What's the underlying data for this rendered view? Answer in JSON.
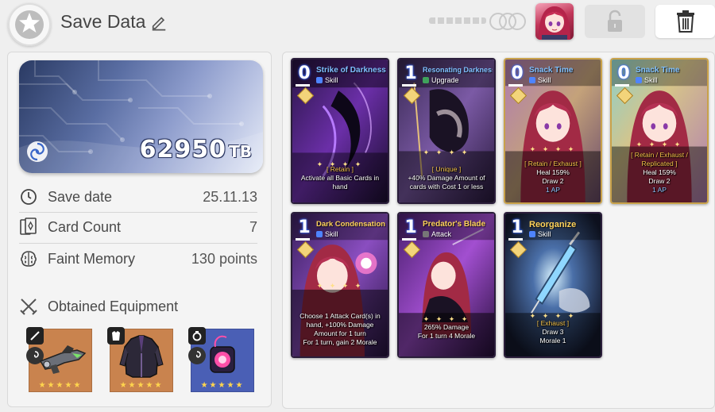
{
  "header": {
    "title": "Save Data"
  },
  "summary": {
    "value": "62950",
    "unit": "TB",
    "rows": [
      {
        "label": "Save date",
        "value": "25.11.13"
      },
      {
        "label": "Card Count",
        "value": "7"
      },
      {
        "label": "Faint Memory",
        "value": "130 points"
      }
    ],
    "equipment_title": "Obtained Equipment",
    "equipment": [
      {
        "name": "weapon",
        "bg": "#c8844f",
        "stars": "★★★★★"
      },
      {
        "name": "armor",
        "bg": "#c8844f",
        "stars": "★★★★★"
      },
      {
        "name": "accessory",
        "bg": "#4b63b8",
        "stars": "★★★★★"
      }
    ]
  },
  "cards": [
    {
      "cost": "0",
      "name": "Strike of Darkness",
      "name_color": "#7fc0ff",
      "type": "Skill",
      "desc": [
        "[ Retain ]",
        "Activate all Basic Cards in hand"
      ]
    },
    {
      "cost": "1",
      "name": "Resonating Darkness",
      "name_color": "#7fc0ff",
      "type": "Upgrade",
      "desc": [
        "[ Unique ]",
        "+40% Damage Amount of cards with Cost 1 or less"
      ]
    },
    {
      "cost": "0",
      "name": "Snack Time",
      "name_color": "#7fc0ff",
      "type": "Skill",
      "desc": [
        "[ Retain / Exhaust ]",
        "Heal 159%",
        "Draw 2",
        "1 AP"
      ]
    },
    {
      "cost": "0",
      "name": "Snack Time",
      "name_color": "#7fc0ff",
      "type": "Skill",
      "desc": [
        "[ Retain / Exhaust / Replicated ]",
        "Heal 159%",
        "Draw 2",
        "1 AP"
      ]
    },
    {
      "cost": "1",
      "name": "Dark Condensation",
      "name_color": "#ffd35a",
      "type": "Skill",
      "desc": [
        "Choose 1 Attack Card(s) in hand, +100% Damage Amount for 1 turn",
        "For 1 turn, gain 2 Morale"
      ]
    },
    {
      "cost": "1",
      "name": "Predator's Blade",
      "name_color": "#ffd35a",
      "type": "Attack",
      "desc": [
        "265% Damage",
        "For 1 turn 4 Morale"
      ]
    },
    {
      "cost": "1",
      "name": "Reorganize",
      "name_color": "#ffd35a",
      "type": "Skill",
      "desc": [
        "[ Exhaust ]",
        "Draw 3",
        "Morale 1"
      ]
    }
  ]
}
